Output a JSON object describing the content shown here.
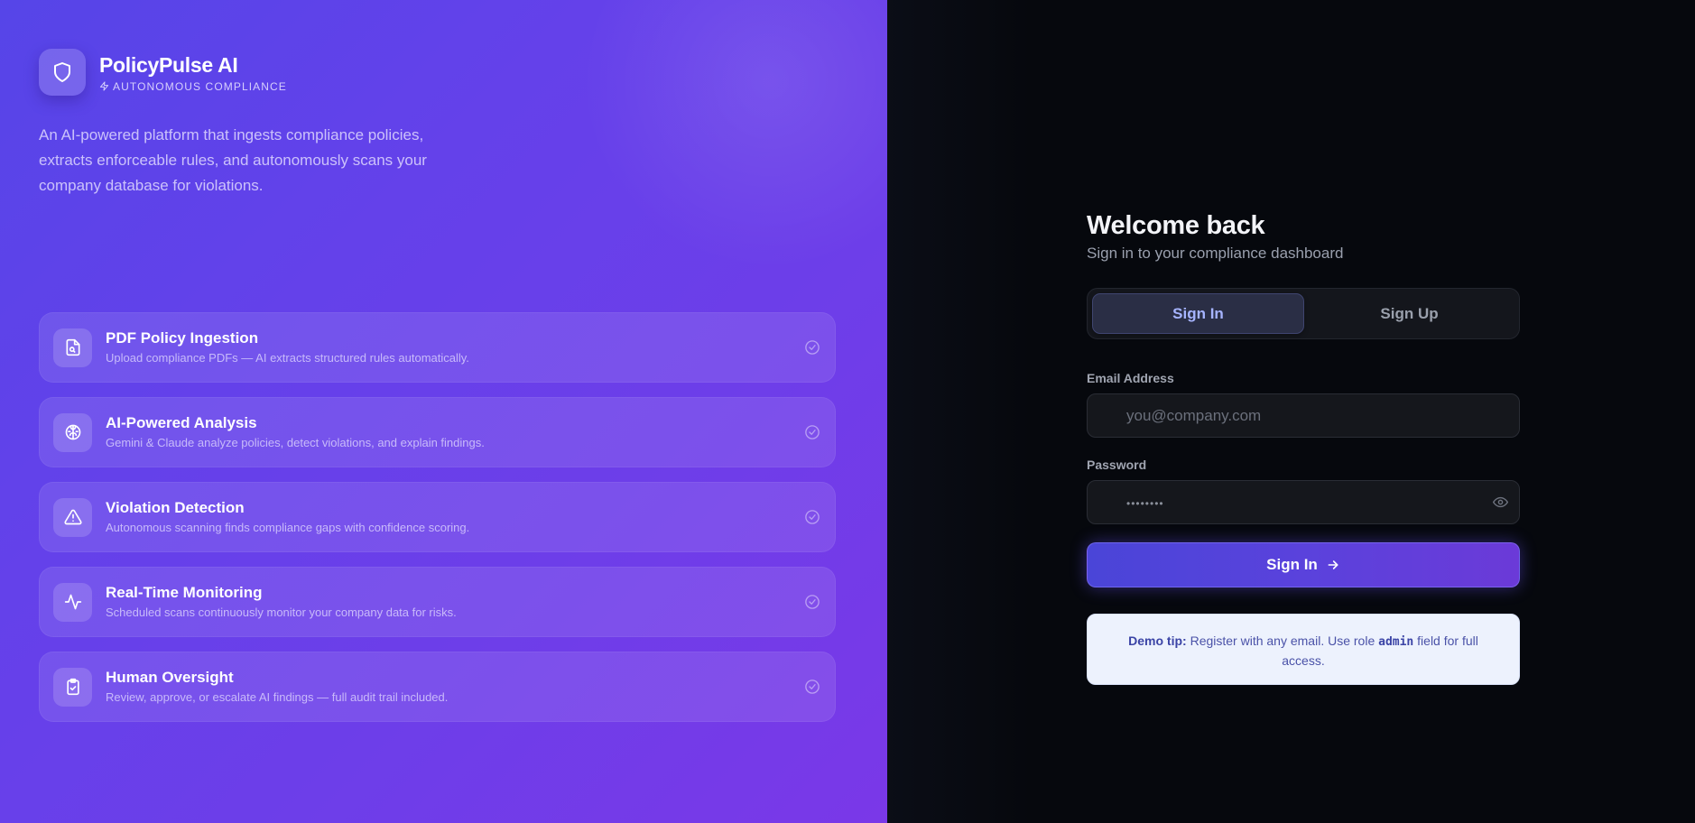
{
  "brand": {
    "name": "PolicyPulse AI",
    "tagline": "AUTONOMOUS COMPLIANCE",
    "description": "An AI-powered platform that ingests compliance policies, extracts enforceable rules, and autonomously scans your company database for violations."
  },
  "features": [
    {
      "icon": "file-search-icon",
      "title": "PDF Policy Ingestion",
      "desc": "Upload compliance PDFs — AI extracts structured rules automatically."
    },
    {
      "icon": "brain-icon",
      "title": "AI-Powered Analysis",
      "desc": "Gemini & Claude analyze policies, detect violations, and explain findings."
    },
    {
      "icon": "alert-triangle-icon",
      "title": "Violation Detection",
      "desc": "Autonomous scanning finds compliance gaps with confidence scoring."
    },
    {
      "icon": "activity-icon",
      "title": "Real-Time Monitoring",
      "desc": "Scheduled scans continuously monitor your company data for risks."
    },
    {
      "icon": "clipboard-check-icon",
      "title": "Human Oversight",
      "desc": "Review, approve, or escalate AI findings — full audit trail included."
    }
  ],
  "auth": {
    "title": "Welcome back",
    "subtitle": "Sign in to your compliance dashboard",
    "tabs": {
      "signin": "Sign In",
      "signup": "Sign Up"
    },
    "email_label": "Email Address",
    "email_placeholder": "you@company.com",
    "password_label": "Password",
    "password_placeholder": "••••••••",
    "submit_label": "Sign In",
    "tip": {
      "prefix": "Demo tip:",
      "text_before": " Register with any email. Use role ",
      "code": "admin",
      "text_after": " field for full access."
    }
  },
  "colors": {
    "accent": "#5a42dc",
    "left_panel_start": "#5645e8",
    "left_panel_end": "#7a38e8",
    "right_panel_bg": "#06080d",
    "tab_active_text": "#a6b4ff"
  }
}
